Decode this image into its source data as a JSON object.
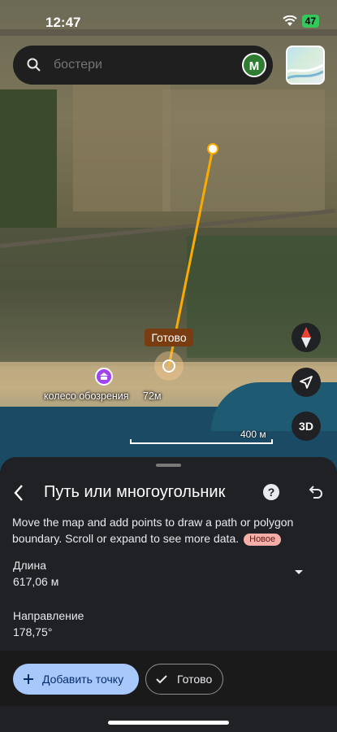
{
  "status": {
    "time": "12:47",
    "battery": "47"
  },
  "search": {
    "placeholder": "бостери",
    "avatar_letter": "M"
  },
  "map": {
    "done_label": "Готово",
    "poi_name": "колесо обозрения",
    "poi_distance": "72м",
    "scale": "400 м"
  },
  "controls": {
    "btn3d": "3D"
  },
  "sheet": {
    "title": "Путь или многоугольник",
    "help": "?",
    "description": "Move the map and add points to draw a path or polygon boundary. Scroll or expand to see more data.",
    "badge": "Новое",
    "length_label": "Длина",
    "length_value": "617,06 м",
    "direction_label": "Направление",
    "direction_value": "178,75°"
  },
  "actions": {
    "add_point": "Добавить точку",
    "done": "Готово"
  },
  "colors": {
    "path": "#f9ab00",
    "accent": "#a8c7fa",
    "badge": "#f6aea9",
    "poi": "#a142f4"
  }
}
